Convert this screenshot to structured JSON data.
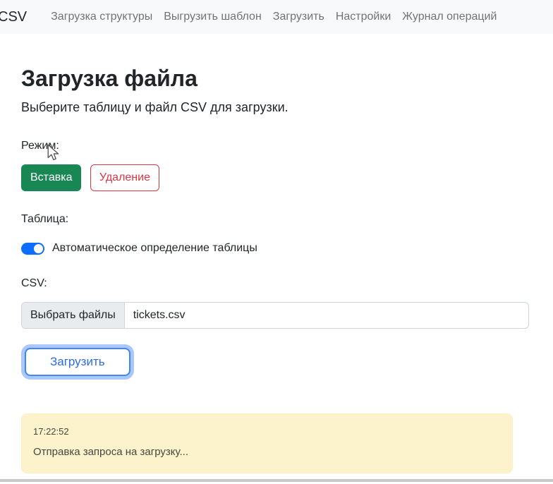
{
  "navbar": {
    "brand": "CSV",
    "items": [
      {
        "label": "Загрузка структуры"
      },
      {
        "label": "Выгрузить шаблон"
      },
      {
        "label": "Загрузить"
      },
      {
        "label": "Настройки"
      },
      {
        "label": "Журнал операций"
      }
    ]
  },
  "main": {
    "title": "Загрузка файла",
    "subtitle": "Выберите таблицу и файл CSV для загрузки.",
    "mode": {
      "label": "Режим:",
      "insert_button": "Вставка",
      "delete_button": "Удаление",
      "selected": "Вставка"
    },
    "table": {
      "label": "Таблица:",
      "auto_detect_label": "Автоматическое определение таблицы",
      "auto_detect_enabled": true
    },
    "csv": {
      "label": "CSV:",
      "file_button": "Выбрать файлы",
      "file_name": "tickets.csv"
    },
    "upload_button": "Загрузить",
    "log": {
      "timestamp": "17:22:52",
      "message": "Отправка запроса на загрузку..."
    }
  },
  "colors": {
    "navbar_bg": "#f8f9fa",
    "success": "#198754",
    "danger": "#dc3545",
    "primary": "#0d6efd",
    "warning_bg": "#fcf3cd"
  }
}
